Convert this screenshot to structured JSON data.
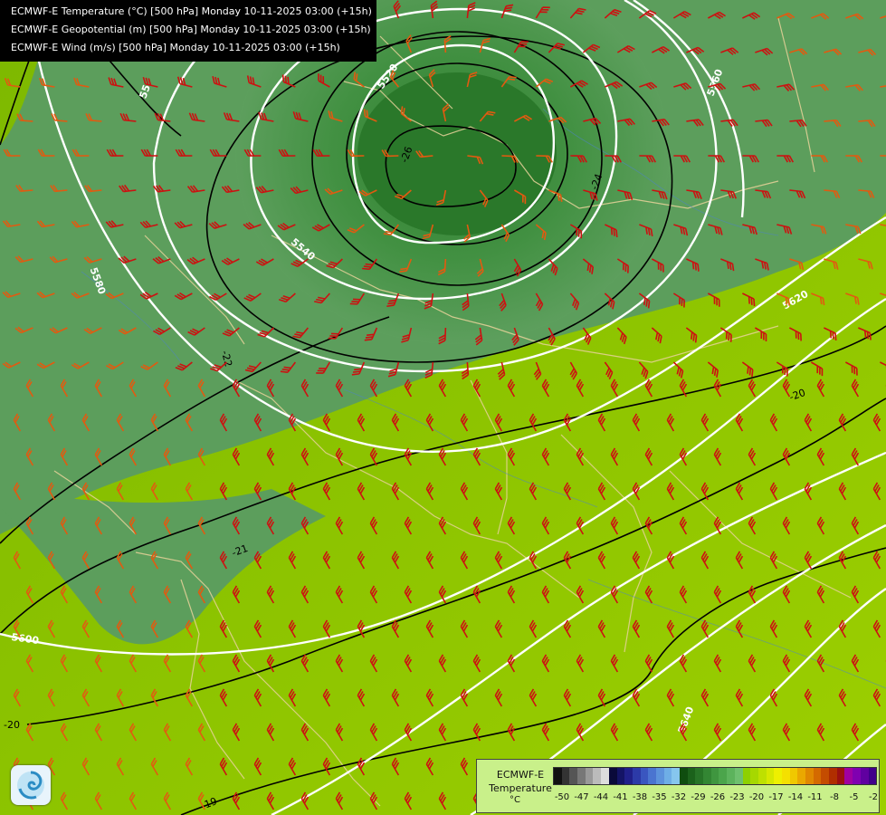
{
  "title_lines": [
    "ECMWF-E Temperature (°C) [500 hPa] Monday 10-11-2025 03:00 (+15h)",
    "ECMWF-E Geopotential (m) [500 hPa] Monday 10-11-2025 03:00 (+15h)",
    "ECMWF-E Wind (m/s) [500 hPa] Monday 10-11-2025 03:00 (+15h)"
  ],
  "geopotential_labels": [
    "5520",
    "5540",
    "5560",
    "5580",
    "5600",
    "5620",
    "5640",
    "55"
  ],
  "temperature_labels": [
    "-26",
    "-24",
    "-22",
    "-21",
    "-20",
    "-20",
    "-19"
  ],
  "legend": {
    "title_line1": "ECMWF-E",
    "title_line2": "Temperature",
    "unit": "°C",
    "ticks": [
      "-50",
      "-47",
      "-44",
      "-41",
      "-38",
      "-35",
      "-32",
      "-29",
      "-26",
      "-23",
      "-20",
      "-17",
      "-14",
      "-11",
      "-8",
      "-5",
      "-2"
    ],
    "colors": [
      "#111111",
      "#333333",
      "#555555",
      "#777777",
      "#999999",
      "#bbbbbb",
      "#dddddd",
      "#0a0a3a",
      "#141466",
      "#20208a",
      "#2c3aa8",
      "#3a56c0",
      "#4a74d0",
      "#5c92dc",
      "#6eaee6",
      "#86c6ee",
      "#0f4d0f",
      "#1b621b",
      "#277427",
      "#338633",
      "#3f963f",
      "#4ba54b",
      "#5cb35c",
      "#6ec06e",
      "#8ed000",
      "#a6d800",
      "#bee000",
      "#d6e800",
      "#eef000",
      "#f4e000",
      "#f0c800",
      "#eaa800",
      "#e08800",
      "#d46a00",
      "#c44c00",
      "#b02e00",
      "#9c1010",
      "#a000a0",
      "#8000b0",
      "#6000a0",
      "#40008a"
    ]
  },
  "colors": {
    "land_background": "#7fb800",
    "cold_core": "#2d7a2d",
    "geopotential_contour": "#ffffff",
    "temperature_contour": "#000000",
    "wind_barb_strong": "#cc1111",
    "wind_barb_medium": "#e25a10",
    "borders": "#e8d29a"
  },
  "icons": {
    "logo": "weather-swirl-logo"
  }
}
